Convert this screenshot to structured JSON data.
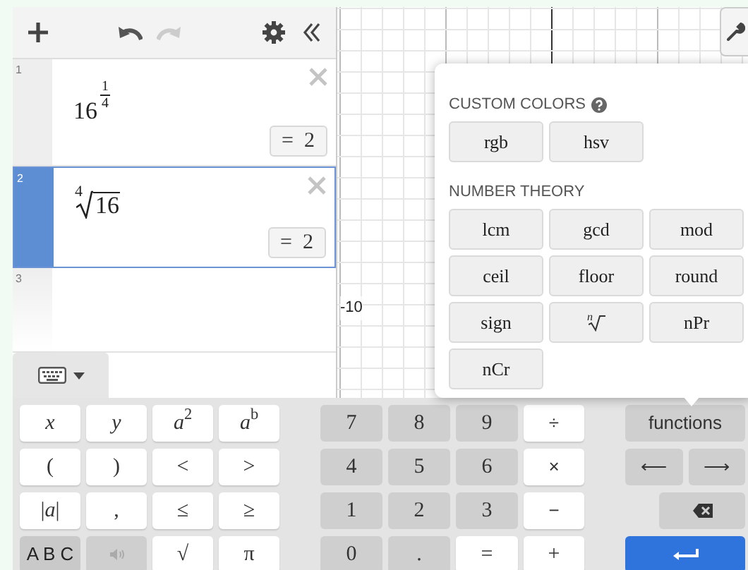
{
  "toolbar": {
    "undo_disabled": false,
    "redo_disabled": true
  },
  "expressions": [
    {
      "index": "1",
      "kind": "power",
      "base": "16",
      "numerator": "1",
      "denominator": "4",
      "result": "= 2",
      "selected": false
    },
    {
      "index": "2",
      "kind": "root",
      "root_index": "4",
      "radicand": "16",
      "result": "= 2",
      "selected": true
    },
    {
      "index": "3",
      "kind": "empty",
      "selected": false
    }
  ],
  "graph": {
    "x_label": "-10"
  },
  "functions_menu": {
    "sections": [
      {
        "title": "CUSTOM COLORS",
        "help": true,
        "buttons": [
          {
            "kind": "text",
            "label": "rgb"
          },
          {
            "kind": "text",
            "label": "hsv"
          }
        ]
      },
      {
        "title": "NUMBER THEORY",
        "help": false,
        "buttons": [
          {
            "kind": "text",
            "label": "lcm"
          },
          {
            "kind": "text",
            "label": "gcd"
          },
          {
            "kind": "text",
            "label": "mod"
          },
          {
            "kind": "text",
            "label": "ceil"
          },
          {
            "kind": "text",
            "label": "floor"
          },
          {
            "kind": "text",
            "label": "round"
          },
          {
            "kind": "text",
            "label": "sign"
          },
          {
            "kind": "nth-root",
            "label": "n"
          },
          {
            "kind": "text",
            "label": "nPr"
          },
          {
            "kind": "text",
            "label": "nCr"
          }
        ]
      }
    ]
  },
  "keyboard_toggle": {
    "expanded": true
  },
  "keypad": {
    "left": [
      {
        "kind": "math-white",
        "label": "*x*"
      },
      {
        "kind": "math-white",
        "label": "*y*"
      },
      {
        "kind": "math-white",
        "label": "*a*$^{2}$"
      },
      {
        "kind": "math-white",
        "label": "*a*$^{b}$"
      },
      {
        "kind": "math-white",
        "label": "("
      },
      {
        "kind": "math-white",
        "label": ")"
      },
      {
        "kind": "math-white",
        "label": "<"
      },
      {
        "kind": "math-white",
        "label": ">"
      },
      {
        "kind": "math-white",
        "label": "|*a*|"
      },
      {
        "kind": "math-white",
        "label": ","
      },
      {
        "kind": "math-white",
        "label": "≤"
      },
      {
        "kind": "math-white",
        "label": "≥"
      },
      {
        "kind": "text-dark",
        "label": "A B C"
      },
      {
        "kind": "speaker"
      },
      {
        "kind": "math-white",
        "label": "√"
      },
      {
        "kind": "math-white",
        "label": "π"
      }
    ],
    "numbers": [
      {
        "kind": "math-gray",
        "label": "7"
      },
      {
        "kind": "math-gray",
        "label": "8"
      },
      {
        "kind": "math-gray",
        "label": "9"
      },
      {
        "kind": "text-white",
        "label": "÷"
      },
      {
        "kind": "math-gray",
        "label": "4"
      },
      {
        "kind": "math-gray",
        "label": "5"
      },
      {
        "kind": "math-gray",
        "label": "6"
      },
      {
        "kind": "text-white",
        "label": "×"
      },
      {
        "kind": "math-gray",
        "label": "1"
      },
      {
        "kind": "math-gray",
        "label": "2"
      },
      {
        "kind": "math-gray",
        "label": "3"
      },
      {
        "kind": "text-white",
        "label": "−"
      },
      {
        "kind": "math-gray",
        "label": "0"
      },
      {
        "kind": "math-gray",
        "label": "."
      },
      {
        "kind": "math-white",
        "label": "="
      },
      {
        "kind": "math-white",
        "label": "+"
      }
    ],
    "right": [
      [
        {
          "kind": "text-gray",
          "label": "functions"
        }
      ],
      [
        {
          "kind": "text-gray",
          "label": "⟵"
        },
        {
          "kind": "text-gray",
          "label": "⟶"
        }
      ],
      [
        {
          "kind": "backspace"
        }
      ],
      [
        {
          "kind": "enter"
        }
      ]
    ]
  }
}
